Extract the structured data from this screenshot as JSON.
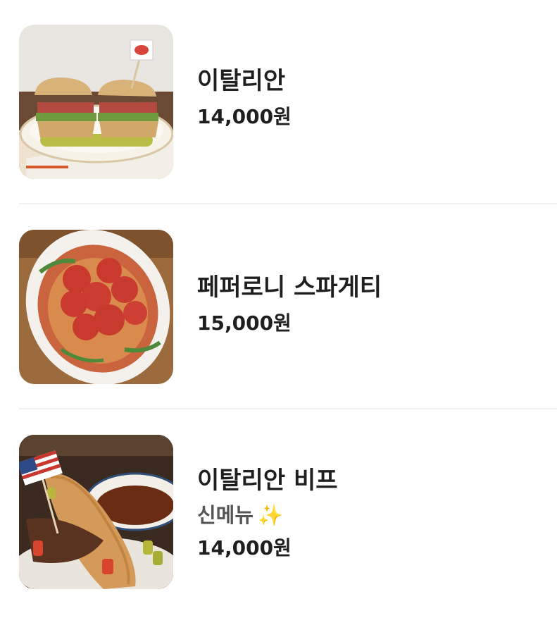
{
  "menu": {
    "items": [
      {
        "name": "이탈리안",
        "price": "14,000원",
        "photo_icon": "sandwich-photo"
      },
      {
        "name": "페퍼로니 스파게티",
        "price": "15,000원",
        "photo_icon": "pepperoni-spaghetti-photo"
      },
      {
        "name": "이탈리안 비프",
        "tag": "신메뉴",
        "tag_emoji": "✨",
        "price": "14,000원",
        "photo_icon": "italian-beef-photo"
      }
    ]
  },
  "colors": {
    "text": "#1f1f1f",
    "subtext": "#555555",
    "divider": "#f1f1f1",
    "sparkle": "#f2b632"
  }
}
